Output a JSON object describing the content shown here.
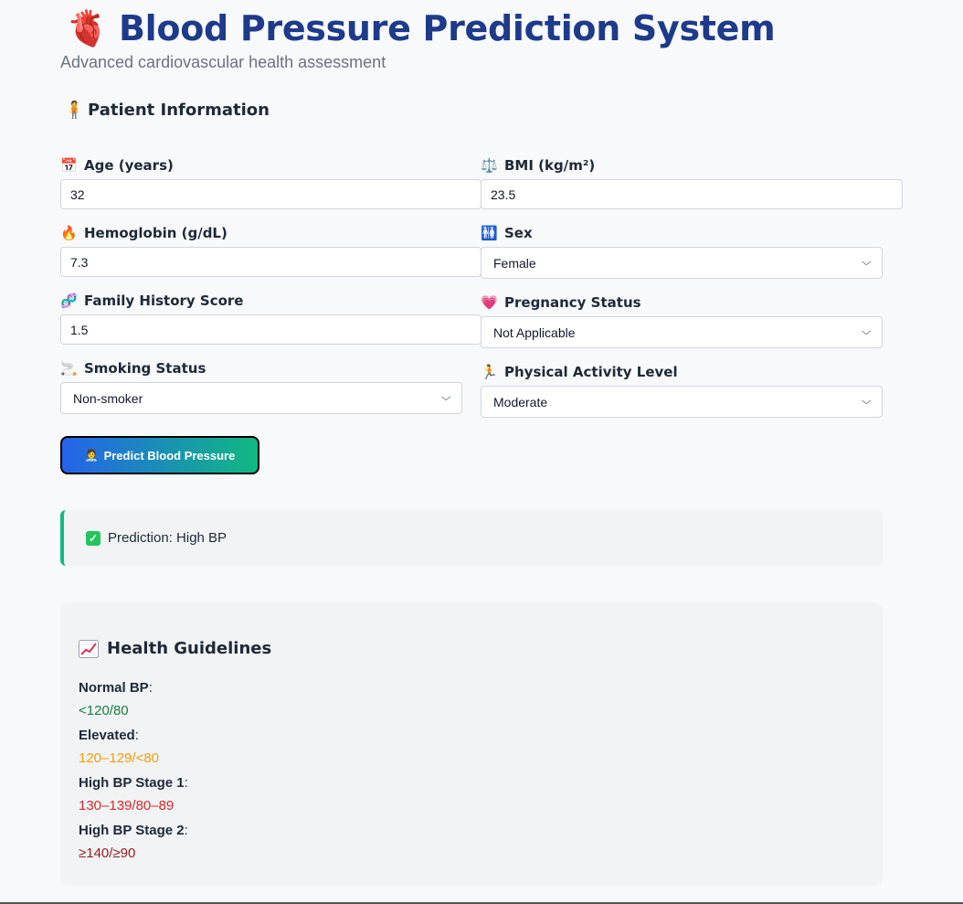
{
  "header": {
    "title": "Blood Pressure Prediction System",
    "subtitle": "Advanced cardiovascular health assessment",
    "icon": "anatomical-heart-icon"
  },
  "patient_section": {
    "title": "Patient Information",
    "icon": "person-standing-icon"
  },
  "fields": {
    "age": {
      "label": "Age (years)",
      "value": "32",
      "icon": "calendar-icon"
    },
    "bmi": {
      "label": "BMI (kg/m²)",
      "value": "23.5",
      "icon": "balance-scale-icon"
    },
    "hemoglobin": {
      "label": "Hemoglobin (g/dL)",
      "value": "7.3",
      "icon": "fire-icon"
    },
    "sex": {
      "label": "Sex",
      "value": "Female",
      "icon": "restroom-icon"
    },
    "family_history": {
      "label": "Family History Score",
      "value": "1.5",
      "icon": "dna-icon"
    },
    "pregnancy": {
      "label": "Pregnancy Status",
      "value": "Not Applicable",
      "icon": "heart-icon"
    },
    "smoking": {
      "label": "Smoking Status",
      "value": "Non-smoker",
      "icon": "cigarette-icon"
    },
    "activity": {
      "label": "Physical Activity Level",
      "value": "Moderate",
      "icon": "running-person-icon"
    }
  },
  "predict_button": {
    "label": "Predict Blood Pressure",
    "icon": "doctor-icon"
  },
  "result": {
    "text": "Prediction: High BP",
    "icon": "check-mark-icon",
    "accent": "#10b981"
  },
  "guidelines": {
    "title": "Health Guidelines",
    "icon": "chart-increasing-icon",
    "items": [
      {
        "label": "Normal BP",
        "value": "<120/80",
        "color": "#15803d"
      },
      {
        "label": "Elevated",
        "value": "120–129/<80",
        "color": "#f59e0b"
      },
      {
        "label": "High BP Stage 1",
        "value": "130–139/80–89",
        "color": "#dc2626"
      },
      {
        "label": "High BP Stage 2",
        "value": "≥140/≥90",
        "color": "#991b1b"
      }
    ]
  },
  "colors": {
    "title": "#1e3a8a",
    "button_gradient_start": "#2563eb",
    "button_gradient_end": "#10b981"
  }
}
